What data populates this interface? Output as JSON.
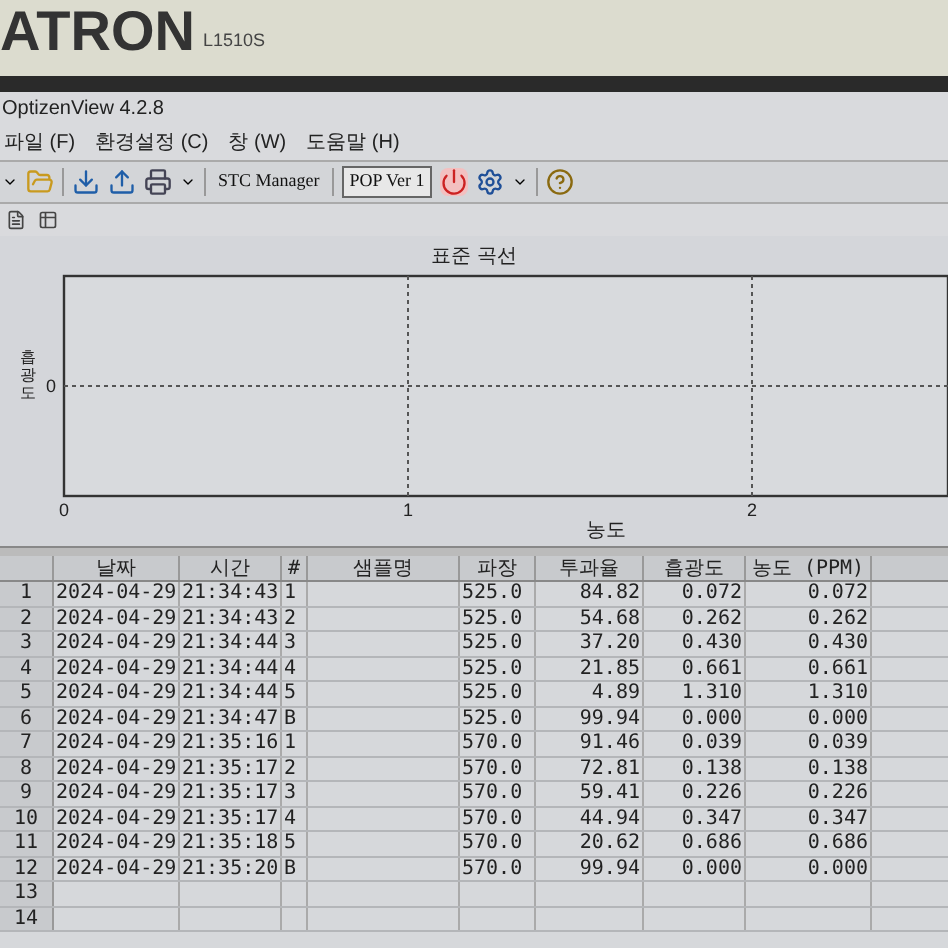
{
  "bezel": {
    "brand": "ATRON",
    "model": "L1510S"
  },
  "window": {
    "title": "OptizenView 4.2.8"
  },
  "menu": [
    "파일 (F)",
    "환경설정 (C)",
    "창 (W)",
    "도움말 (H)"
  ],
  "toolbar": {
    "stc_button": "STC Manager",
    "pop_button": "POP Ver 1"
  },
  "chart": {
    "chart_data": {
      "type": "other",
      "title": "표준 곡선",
      "xlabel": "농도",
      "ylabel": "흡광도",
      "annotations": [
        {
          "text": "0"
        },
        {
          "text": "0"
        },
        {
          "text": "1"
        },
        {
          "text": "2"
        }
      ]
    }
  },
  "table": {
    "columns": [
      "날짜",
      "시간",
      "#",
      "샘플명",
      "파장",
      "투과율",
      "흡광도",
      "농도 (PPM)"
    ],
    "rows": [
      {
        "no": "1",
        "cells": [
          "2024-04-29",
          "21:34:43",
          "1",
          "",
          "525.0",
          "84.82",
          "0.072",
          "0.072"
        ]
      },
      {
        "no": "2",
        "cells": [
          "2024-04-29",
          "21:34:43",
          "2",
          "",
          "525.0",
          "54.68",
          "0.262",
          "0.262"
        ]
      },
      {
        "no": "3",
        "cells": [
          "2024-04-29",
          "21:34:44",
          "3",
          "",
          "525.0",
          "37.20",
          "0.430",
          "0.430"
        ]
      },
      {
        "no": "4",
        "cells": [
          "2024-04-29",
          "21:34:44",
          "4",
          "",
          "525.0",
          "21.85",
          "0.661",
          "0.661"
        ]
      },
      {
        "no": "5",
        "cells": [
          "2024-04-29",
          "21:34:44",
          "5",
          "",
          "525.0",
          "4.89",
          "1.310",
          "1.310"
        ]
      },
      {
        "no": "6",
        "cells": [
          "2024-04-29",
          "21:34:47",
          "B",
          "",
          "525.0",
          "99.94",
          "0.000",
          "0.000"
        ]
      },
      {
        "no": "7",
        "cells": [
          "2024-04-29",
          "21:35:16",
          "1",
          "",
          "570.0",
          "91.46",
          "0.039",
          "0.039"
        ]
      },
      {
        "no": "8",
        "cells": [
          "2024-04-29",
          "21:35:17",
          "2",
          "",
          "570.0",
          "72.81",
          "0.138",
          "0.138"
        ]
      },
      {
        "no": "9",
        "cells": [
          "2024-04-29",
          "21:35:17",
          "3",
          "",
          "570.0",
          "59.41",
          "0.226",
          "0.226"
        ]
      },
      {
        "no": "10",
        "cells": [
          "2024-04-29",
          "21:35:17",
          "4",
          "",
          "570.0",
          "44.94",
          "0.347",
          "0.347"
        ]
      },
      {
        "no": "11",
        "cells": [
          "2024-04-29",
          "21:35:18",
          "5",
          "",
          "570.0",
          "20.62",
          "0.686",
          "0.686"
        ]
      },
      {
        "no": "12",
        "cells": [
          "2024-04-29",
          "21:35:20",
          "B",
          "",
          "570.0",
          "99.94",
          "0.000",
          "0.000"
        ]
      },
      {
        "no": "13",
        "cells": [
          "",
          "",
          "",
          "",
          "",
          "",
          "",
          ""
        ]
      },
      {
        "no": "14",
        "cells": [
          "",
          "",
          "",
          "",
          "",
          "",
          "",
          ""
        ]
      }
    ]
  }
}
